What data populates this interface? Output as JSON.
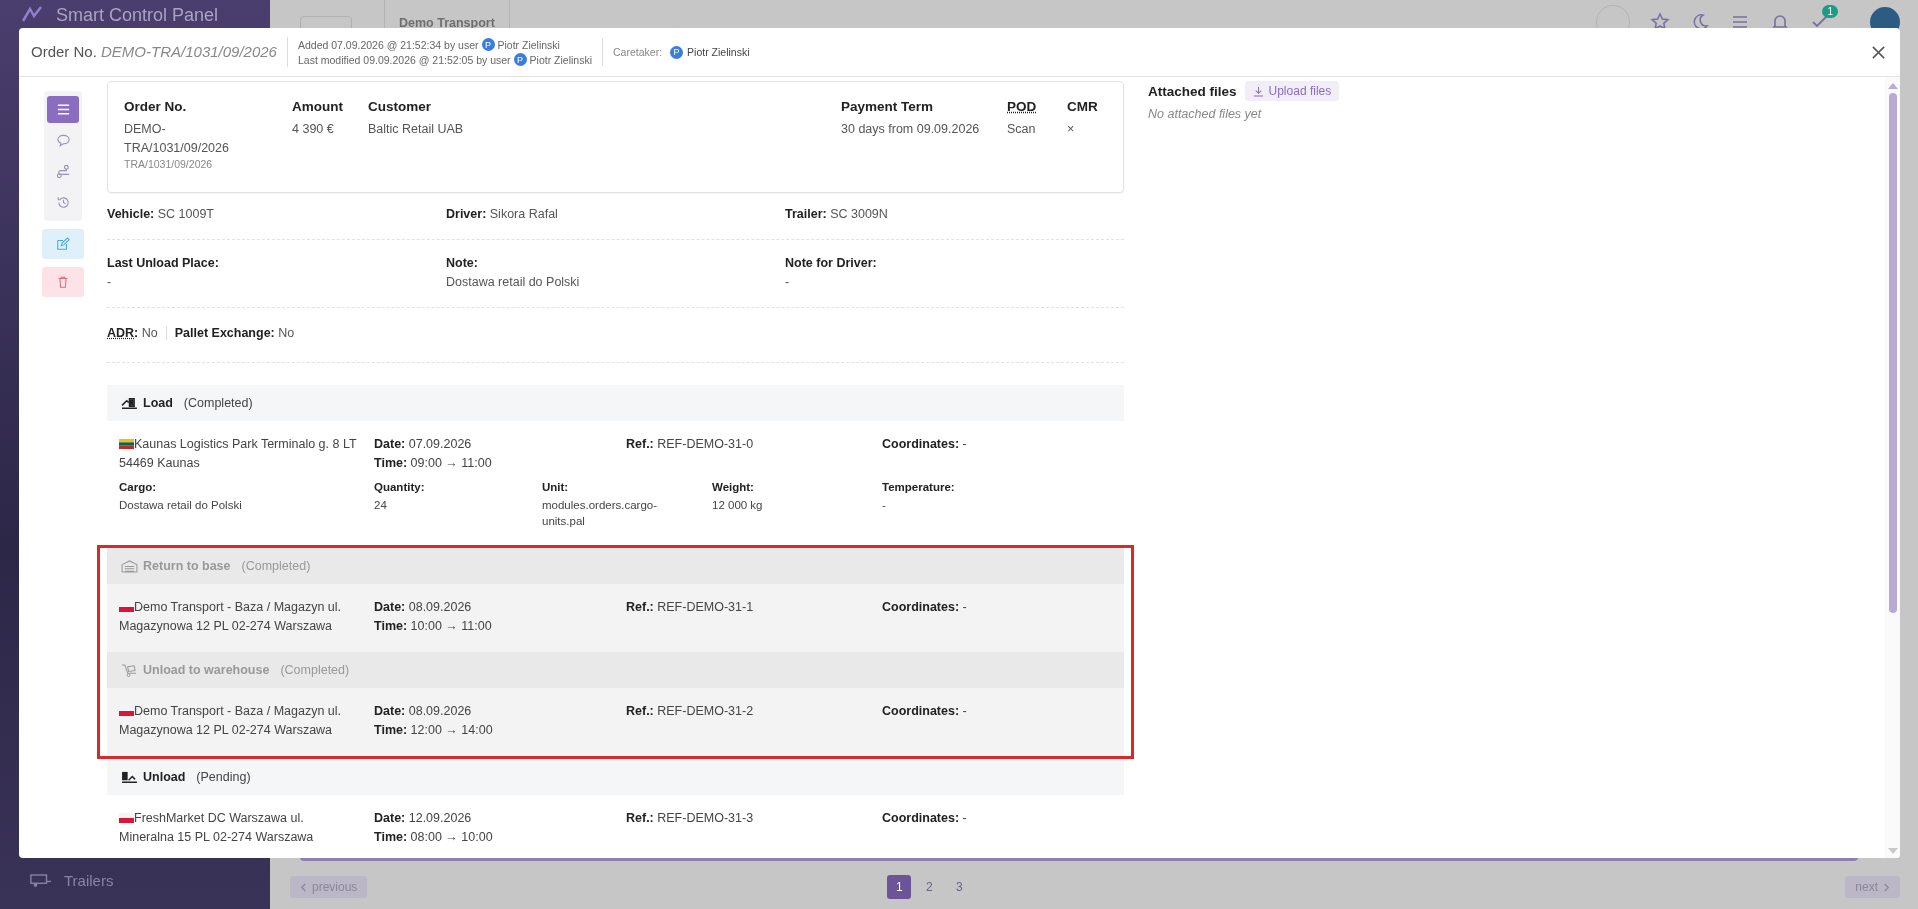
{
  "background_page": {
    "app_title": "Smart Control Panel",
    "tab": "Demo Transport",
    "notification_badge": "1",
    "sidebar_items": [
      {
        "label": "Trailers"
      }
    ],
    "pagination": {
      "previous": "previous",
      "next": "next",
      "pages": [
        {
          "label": "1",
          "selected": true
        },
        {
          "label": "2",
          "selected": false
        },
        {
          "label": "3",
          "selected": false
        }
      ]
    }
  },
  "modal": {
    "title_label": "Order No.",
    "order_number": "DEMO-TRA/1031/09/2026",
    "audit": [
      {
        "text": "Added 07.09.2026 @ 21:52:34 by user",
        "avatar": "P",
        "user": "Piotr Zielinski"
      },
      {
        "text": "Last modified 09.09.2026 @ 21:52:05 by user",
        "avatar": "P",
        "user": "Piotr Zielinski"
      }
    ],
    "caretaker": {
      "label": "Caretaker:",
      "avatar": "P",
      "user": "Piotr Zielinski"
    },
    "toolbar": [
      {
        "kind": "menu",
        "selected": true
      },
      {
        "kind": "comments",
        "selected": false
      },
      {
        "kind": "route",
        "selected": false
      },
      {
        "kind": "history",
        "selected": false
      }
    ],
    "actions": [
      {
        "kind": "edit"
      },
      {
        "kind": "delete"
      }
    ],
    "summary": [
      {
        "label": "Order No.",
        "value": "DEMO-TRA/1031/09/2026",
        "sub": "TRA/1031/09/2026"
      },
      {
        "label": "Amount",
        "value": "4 390 €"
      },
      {
        "label": "Customer",
        "value": "Baltic Retail UAB"
      },
      {
        "label": "Payment Term",
        "value": "30 days from 09.09.2026"
      },
      {
        "label": "POD",
        "value": "Scan",
        "abbreviation": true
      },
      {
        "label": "CMR",
        "value": "×"
      }
    ],
    "transport": [
      {
        "label": "Vehicle:",
        "value": "SC 1009T"
      },
      {
        "label": "Driver:",
        "value": "Sikora Rafal"
      },
      {
        "label": "Trailer:",
        "value": "SC 3009N"
      }
    ],
    "notes": [
      {
        "label": "Last Unload Place:",
        "value": "-"
      },
      {
        "label": "Note:",
        "value": "Dostawa retail do Polski"
      },
      {
        "label": "Note for Driver:",
        "value": "-"
      }
    ],
    "flags": [
      {
        "label": "ADR",
        "suffix": ":",
        "value": "No",
        "abbreviation": true
      },
      {
        "label": "Pallet Exchange:",
        "value": "No",
        "abbreviation": false
      }
    ],
    "stop_groups": [
      {
        "highlighted": false,
        "stops": [
          {
            "kind": "load",
            "muted": false,
            "title": "Load",
            "status": "(Completed)",
            "flag_stripes": [
              {
                "color": "#fdb913"
              },
              {
                "color": "#006a44"
              },
              {
                "color": "#c1272d"
              }
            ],
            "address": "Kaunas Logistics Park Terminalo g. 8 LT 54469 Kaunas",
            "date_label": "Date:",
            "date": "07.09.2026",
            "time_label": "Time:",
            "time": "09:00 → 11:00",
            "ref_label": "Ref.:",
            "ref": "REF-DEMO-31-0",
            "coord_label": "Coordinates:",
            "coords": "-",
            "cargo": [
              {
                "label": "Cargo:",
                "value": "Dostawa retail do Polski"
              },
              {
                "label": "Quantity:",
                "value": "24"
              },
              {
                "label": "Unit:",
                "value": "modules.orders.cargo-units.pal"
              },
              {
                "label": "Weight:",
                "value": "12 000 kg"
              },
              {
                "label": "Temperature:",
                "value": "-"
              }
            ]
          }
        ]
      },
      {
        "highlighted": true,
        "stops": [
          {
            "kind": "return",
            "muted": true,
            "title": "Return to base",
            "status": "(Completed)",
            "flag_stripes": [
              {
                "color": "#f4f4f4"
              },
              {
                "color": "#dc143c"
              }
            ],
            "address": "Demo Transport - Baza / Magazyn ul. Magazynowa 12 PL 02-274 Warszawa",
            "date_label": "Date:",
            "date": "08.09.2026",
            "time_label": "Time:",
            "time": "10:00 → 11:00",
            "ref_label": "Ref.:",
            "ref": "REF-DEMO-31-1",
            "coord_label": "Coordinates:",
            "coords": "-"
          },
          {
            "kind": "warehouse",
            "muted": true,
            "title": "Unload to warehouse",
            "status": "(Completed)",
            "flag_stripes": [
              {
                "color": "#f4f4f4"
              },
              {
                "color": "#dc143c"
              }
            ],
            "address": "Demo Transport - Baza / Magazyn ul. Magazynowa 12 PL 02-274 Warszawa",
            "date_label": "Date:",
            "date": "08.09.2026",
            "time_label": "Time:",
            "time": "12:00 → 14:00",
            "ref_label": "Ref.:",
            "ref": "REF-DEMO-31-2",
            "coord_label": "Coordinates:",
            "coords": "-"
          }
        ]
      },
      {
        "highlighted": false,
        "stops": [
          {
            "kind": "unload",
            "muted": false,
            "title": "Unload",
            "status": "(Pending)",
            "flag_stripes": [
              {
                "color": "#f4f4f4"
              },
              {
                "color": "#dc143c"
              }
            ],
            "address": "FreshMarket DC Warszawa ul. Mineralna 15 PL 02-274 Warszawa",
            "date_label": "Date:",
            "date": "12.09.2026",
            "time_label": "Time:",
            "time": "08:00 → 10:00",
            "ref_label": "Ref.:",
            "ref": "REF-DEMO-31-3",
            "coord_label": "Coordinates:",
            "coords": "-"
          }
        ]
      }
    ],
    "attachments": {
      "title": "Attached files",
      "upload": "Upload files",
      "empty": "No attached files yet"
    }
  }
}
